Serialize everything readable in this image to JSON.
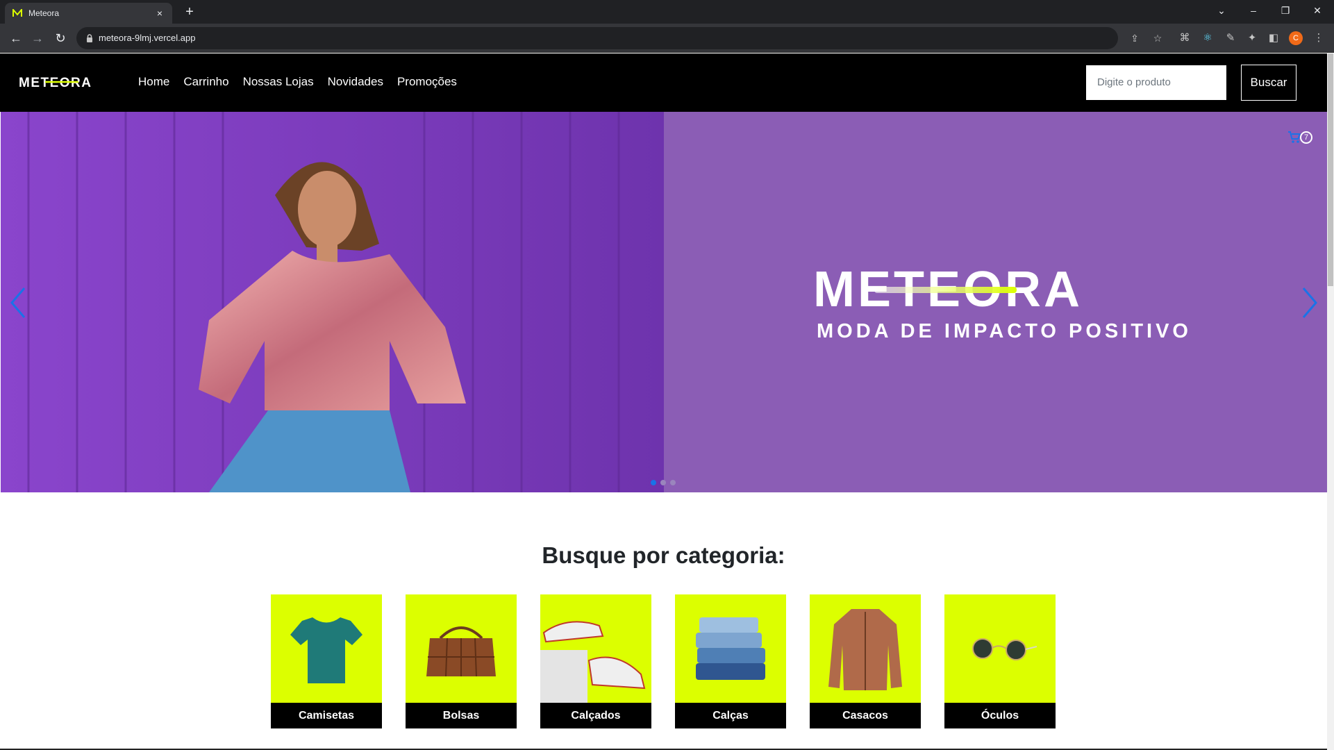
{
  "browser": {
    "tab_title": "Meteora",
    "tab_close": "×",
    "new_tab": "+",
    "url": "meteora-9lmj.vercel.app",
    "profile_initial": "C",
    "window_controls": [
      "⌄",
      "–",
      "❐",
      "✕"
    ]
  },
  "site": {
    "logo": "METEORA",
    "nav": [
      "Home",
      "Carrinho",
      "Nossas Lojas",
      "Novidades",
      "Promoções"
    ],
    "search_placeholder": "Digite o produto",
    "search_button": "Buscar"
  },
  "hero": {
    "brand": "METEORA",
    "tagline": "MODA DE IMPACTO POSITIVO",
    "cart_count": "7",
    "slides": 3,
    "active_slide": 0,
    "bg_color": "#8b5db5"
  },
  "categories": {
    "heading": "Busque por categoria:",
    "items": [
      {
        "label": "Camisetas",
        "icon": "tshirt-icon"
      },
      {
        "label": "Bolsas",
        "icon": "bag-icon"
      },
      {
        "label": "Calçados",
        "icon": "sneakers-icon"
      },
      {
        "label": "Calças",
        "icon": "jeans-icon"
      },
      {
        "label": "Casacos",
        "icon": "jacket-icon"
      },
      {
        "label": "Óculos",
        "icon": "sunglasses-icon"
      }
    ],
    "accent": "#dcff00"
  }
}
